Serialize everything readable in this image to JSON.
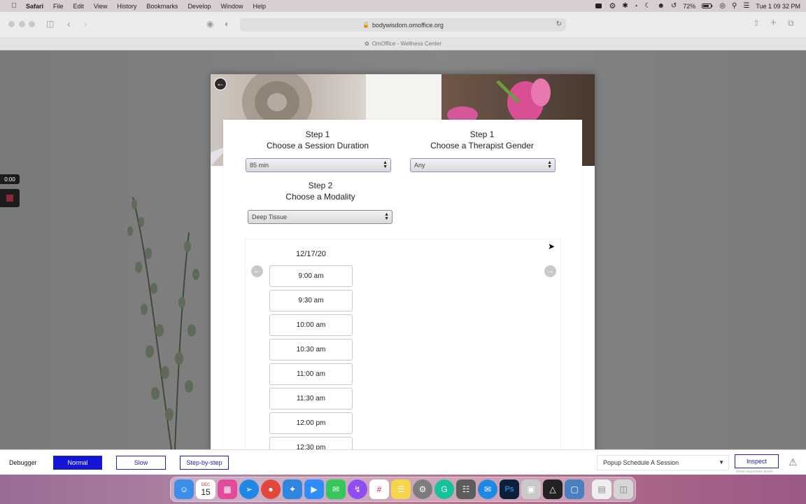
{
  "menubar": {
    "app_name": "Safari",
    "items": [
      "File",
      "Edit",
      "View",
      "History",
      "Bookmarks",
      "Develop",
      "Window",
      "Help"
    ],
    "battery": "72%",
    "clock": "Tue 1 09 32 PM"
  },
  "browser": {
    "url": "bodywisdom.omoffice.org",
    "tab_title": "OmOffice - Wellness Center"
  },
  "recording": {
    "time": "0:00"
  },
  "booking": {
    "duration_step": "Step 1",
    "duration_title": "Choose a Session Duration",
    "duration_value": "85 min",
    "gender_step": "Step 1",
    "gender_title": "Choose a Therapist Gender",
    "gender_value": "Any",
    "modality_step": "Step 2",
    "modality_title": "Choose a Modality",
    "modality_value": "Deep Tissue",
    "date": "12/17/20",
    "slots": [
      "9:00 am",
      "9:30 am",
      "10:00 am",
      "10:30 am",
      "11:00 am",
      "11:30 am",
      "12:00 pm",
      "12:30 pm"
    ]
  },
  "debugger": {
    "label": "Debugger",
    "normal": "Normal",
    "slow": "Slow",
    "step": "Step-by-step",
    "selected_flow": "Popup Schedule A Session",
    "inspect": "Inspect",
    "hint": "Show responsive boxes"
  },
  "dock": {
    "calendar_month": "DEC",
    "calendar_day": "15",
    "icons": [
      "finder-icon",
      "calendar-icon",
      "launchpad-icon",
      "safari-icon",
      "chrome-icon",
      "sourcetree-icon",
      "zoom-icon",
      "messages-icon",
      "messenger-icon",
      "slack-icon",
      "notes-icon",
      "system-preferences-icon",
      "grammarly-icon",
      "calculator-icon",
      "chat-icon",
      "photoshop-icon",
      "preview-icon",
      "unity-icon",
      "screenshot-icon",
      "document-icon",
      "trash-icon"
    ]
  }
}
